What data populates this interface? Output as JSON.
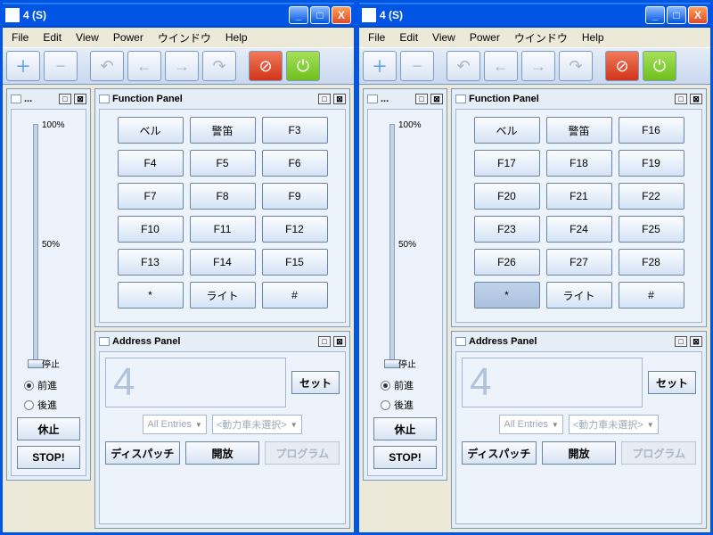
{
  "title": "4 (S)",
  "menu": {
    "file": "File",
    "edit": "Edit",
    "view": "View",
    "power": "Power",
    "window": "ウインドウ",
    "help": "Help"
  },
  "toolbar_icons": {
    "plus": "＋",
    "minus": "−",
    "undo": "↶",
    "back": "←",
    "fwd": "→",
    "redo": "↷",
    "stop": "⊘",
    "power": "⏻"
  },
  "throttle": {
    "ellipsis": "...",
    "ticks": {
      "t100": "100%",
      "t50": "50%",
      "stop": "停止"
    },
    "forward": "前進",
    "reverse": "後進",
    "idle": "休止",
    "stop": "STOP!"
  },
  "fn": {
    "title": "Function Panel",
    "left": [
      "ベル",
      "警笛",
      "F3",
      "F4",
      "F5",
      "F6",
      "F7",
      "F8",
      "F9",
      "F10",
      "F11",
      "F12",
      "F13",
      "F14",
      "F15",
      "*",
      "ライト",
      "#"
    ],
    "right": [
      "ベル",
      "警笛",
      "F16",
      "F17",
      "F18",
      "F19",
      "F20",
      "F21",
      "F22",
      "F23",
      "F24",
      "F25",
      "F26",
      "F27",
      "F28",
      "*",
      "ライト",
      "#"
    ],
    "pressed_right": "*"
  },
  "addr": {
    "title": "Address Panel",
    "value": "4",
    "set": "セット",
    "combo1": "All Entries",
    "combo2": "<動力車未選択>",
    "dispatch": "ディスパッチ",
    "release": "開放",
    "program": "プログラム"
  }
}
